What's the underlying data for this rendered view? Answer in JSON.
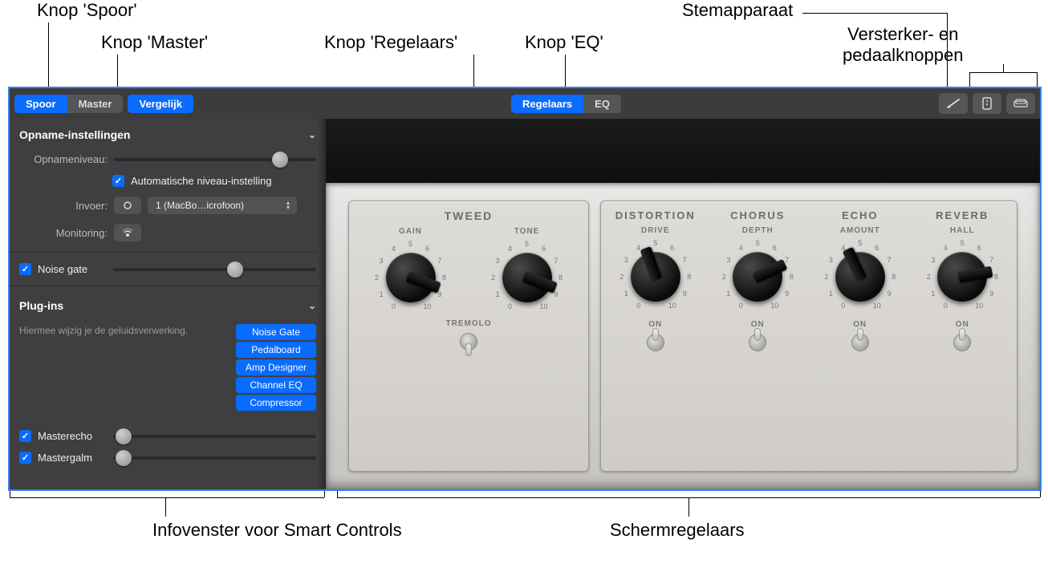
{
  "callouts": {
    "spoor": "Knop 'Spoor'",
    "master": "Knop 'Master'",
    "regelaars": "Knop 'Regelaars'",
    "eq": "Knop 'EQ'",
    "tuner": "Stemapparaat",
    "amp_pedal": "Versterker- en\npedaalknoppen",
    "info_panel": "Infovenster voor\nSmart Controls",
    "screen_controls": "Schermregelaars"
  },
  "toolbar": {
    "spoor": "Spoor",
    "master": "Master",
    "vergelijk": "Vergelijk",
    "regelaars": "Regelaars",
    "eq": "EQ"
  },
  "sidebar": {
    "section_record": "Opname-instellingen",
    "level_label": "Opnameniveau:",
    "level_value": 0.82,
    "auto_level": "Automatische niveau-instelling",
    "input_label": "Invoer:",
    "input_selected": "1 (MacBo…icrofoon)",
    "monitoring_label": "Monitoring:",
    "noise_gate": "Noise gate",
    "noise_gate_value": 0.6,
    "section_plugins": "Plug-ins",
    "plugin_hint": "Hiermee wijzig je de\ngeluidsverwerking.",
    "plugins": [
      "Noise Gate",
      "Pedalboard",
      "Amp Designer",
      "Channel EQ",
      "Compressor"
    ],
    "masterecho": "Masterecho",
    "masterecho_value": 0.05,
    "mastergalm": "Mastergalm",
    "mastergalm_value": 0.05
  },
  "rack": {
    "tweed": {
      "title": "TWEED",
      "knobs": [
        {
          "label": "GAIN",
          "angle": 20
        },
        {
          "label": "TONE",
          "angle": 20
        }
      ],
      "tremolo_label": "TREMOLO"
    },
    "effects": {
      "groups": [
        {
          "title": "DISTORTION",
          "knob": "DRIVE",
          "angle": -110,
          "switch": "ON"
        },
        {
          "title": "CHORUS",
          "knob": "DEPTH",
          "angle": -25,
          "switch": "ON"
        },
        {
          "title": "ECHO",
          "knob": "AMOUNT",
          "angle": -115,
          "switch": "ON"
        },
        {
          "title": "REVERB",
          "knob": "HALL",
          "angle": -10,
          "switch": "ON"
        }
      ]
    },
    "scale": [
      "0",
      "1",
      "2",
      "3",
      "4",
      "5",
      "6",
      "7",
      "8",
      "9",
      "10"
    ]
  }
}
